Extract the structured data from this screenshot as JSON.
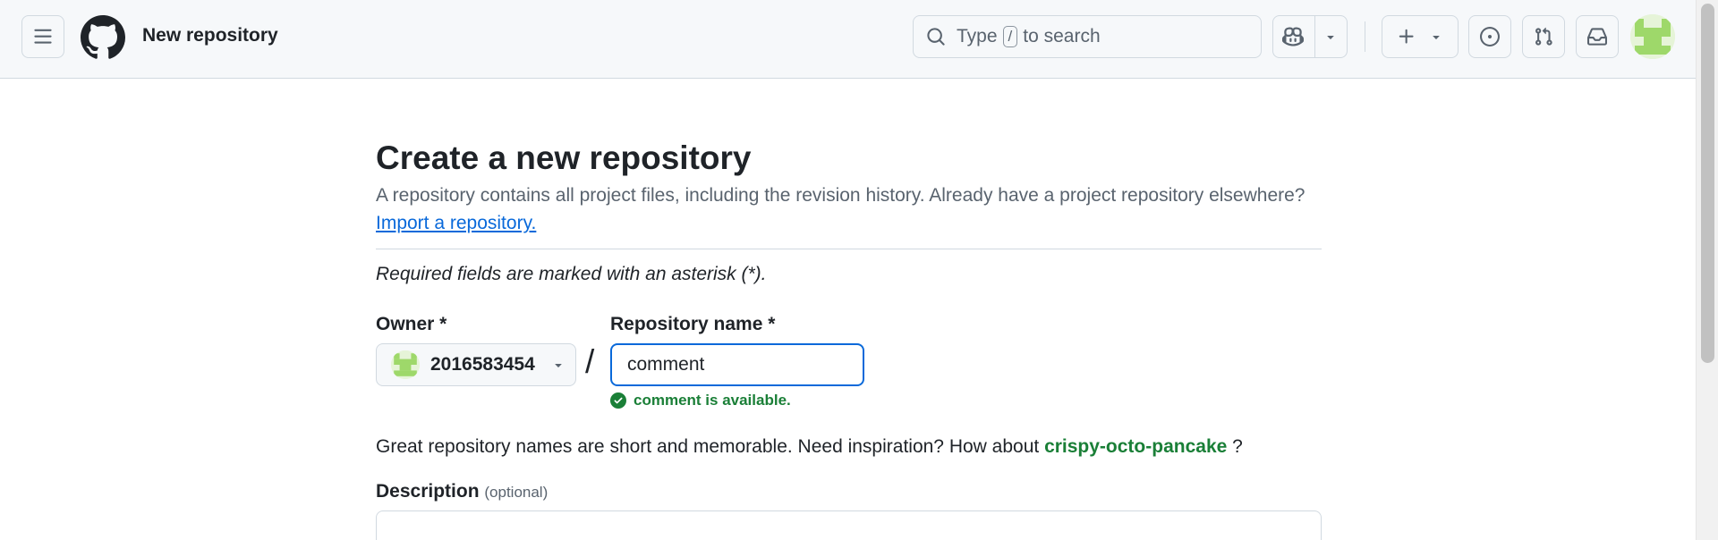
{
  "header": {
    "page_title": "New repository",
    "search": {
      "prefix": "Type",
      "key": "/",
      "suffix": "to search"
    }
  },
  "main": {
    "heading": "Create a new repository",
    "lead": "A repository contains all project files, including the revision history. Already have a project repository elsewhere?",
    "import_link": "Import a repository.",
    "required_note": "Required fields are marked with an asterisk (*).",
    "owner": {
      "label": "Owner *",
      "value": "2016583454"
    },
    "slash": "/",
    "repo_name": {
      "label": "Repository name *",
      "value": "comment",
      "availability": "comment is available."
    },
    "inspiration": {
      "text": "Great repository names are short and memorable. Need inspiration? How about",
      "suggestion": "crispy-octo-pancake",
      "suffix": "?"
    },
    "description": {
      "label": "Description",
      "optional": "(optional)"
    }
  },
  "colors": {
    "accent": "#0969da",
    "success": "#1a7f37",
    "header_bg": "#f6f8fa",
    "border": "#d1d9e0"
  },
  "icons": [
    "hamburger-icon",
    "github-logo-icon",
    "search-icon",
    "copilot-icon",
    "chevron-down-icon",
    "plus-icon",
    "issues-icon",
    "pull-request-icon",
    "inbox-icon",
    "check-circle-icon",
    "avatar-identicon"
  ]
}
